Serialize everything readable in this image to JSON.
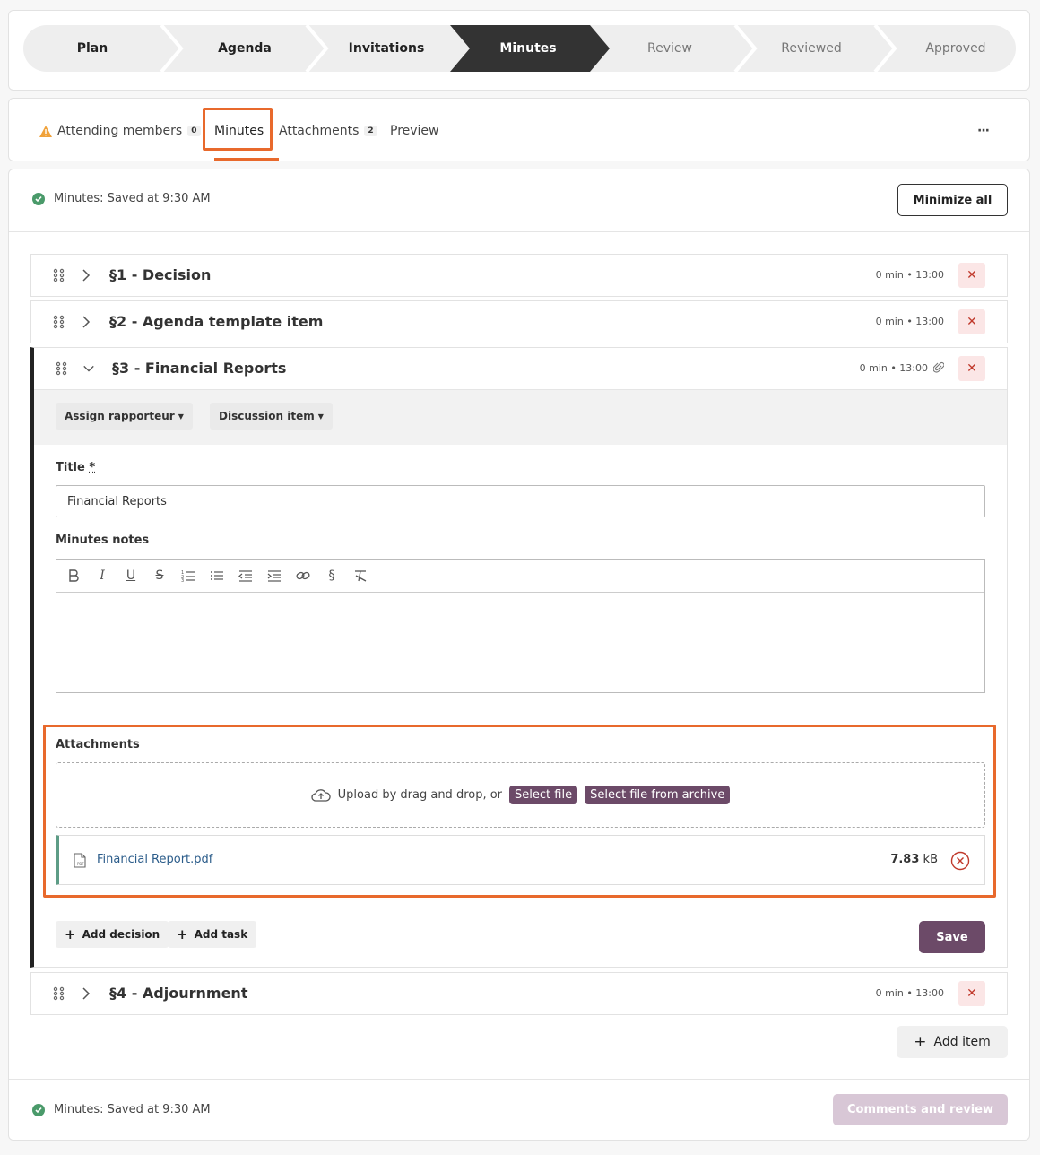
{
  "stepper": {
    "steps": [
      {
        "label": "Plan",
        "state": "done"
      },
      {
        "label": "Agenda",
        "state": "done"
      },
      {
        "label": "Invitations",
        "state": "done"
      },
      {
        "label": "Minutes",
        "state": "active"
      },
      {
        "label": "Review",
        "state": "future"
      },
      {
        "label": "Reviewed",
        "state": "future"
      },
      {
        "label": "Approved",
        "state": "future"
      }
    ]
  },
  "tabs": {
    "items": [
      {
        "label": "Attending members",
        "count": "0",
        "warning": true
      },
      {
        "label": "Minutes",
        "active": true
      },
      {
        "label": "Attachments",
        "count": "2"
      },
      {
        "label": "Preview"
      }
    ],
    "more_label": "···"
  },
  "status": {
    "top": "Minutes: Saved at 9:30 AM",
    "bottom": "Minutes: Saved at 9:30 AM"
  },
  "actions": {
    "minimize_all": "Minimize all",
    "add_item": "Add item",
    "comments_review": "Comments and review"
  },
  "agenda_items": [
    {
      "title": "§1 - Decision",
      "meta": "0 min • 13:00"
    },
    {
      "title": "§2 - Agenda template item",
      "meta": "0 min • 13:00"
    },
    {
      "title": "§3 - Financial Reports",
      "meta": "0 min • 13:00",
      "expanded": true
    },
    {
      "title": "§4 - Adjournment",
      "meta": "0 min • 13:00"
    }
  ],
  "expanded_item": {
    "assign_rapporteur": "Assign rapporteur",
    "discussion_item": "Discussion item",
    "title_label": "Title",
    "title_required": "*",
    "title_value": "Financial Reports",
    "notes_label": "Minutes notes",
    "editor_tools": [
      "B",
      "I",
      "U",
      "S",
      "ordered-list",
      "bullet-list",
      "outdent",
      "indent",
      "link",
      "§",
      "clear-format"
    ],
    "attachments_label": "Attachments",
    "upload_text": "Upload by drag and drop, or",
    "select_file": "Select file",
    "select_archive": "Select file from archive",
    "file": {
      "name": "Financial Report.pdf",
      "size": "7.83",
      "unit": "kB"
    },
    "add_decision": "Add decision",
    "add_task": "Add task",
    "save": "Save"
  },
  "colors": {
    "accent_highlight": "#e8692c",
    "brand": "#6c4a68",
    "success": "#4a9a6a",
    "danger": "#c0392b",
    "active_step": "#333333"
  }
}
